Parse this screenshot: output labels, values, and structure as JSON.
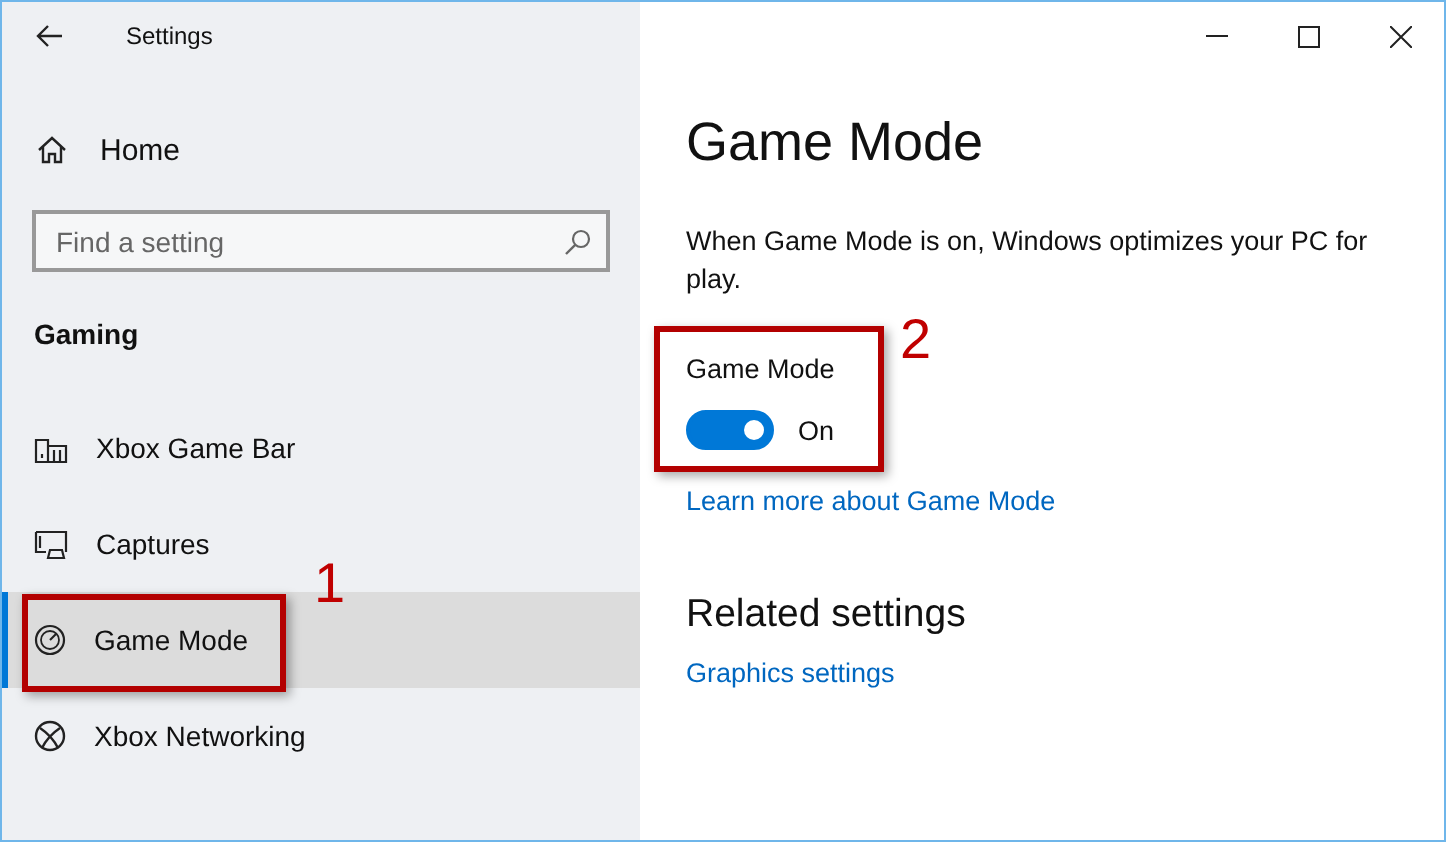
{
  "window": {
    "title": "Settings"
  },
  "sidebar": {
    "home": "Home",
    "search": {
      "placeholder": "Find a setting"
    },
    "section": "Gaming",
    "items": [
      {
        "label": "Xbox Game Bar",
        "selected": false
      },
      {
        "label": "Captures",
        "selected": false
      },
      {
        "label": "Game Mode",
        "selected": true
      },
      {
        "label": "Xbox Networking",
        "selected": false
      }
    ]
  },
  "page": {
    "title": "Game Mode",
    "description": "When Game Mode is on, Windows optimizes your PC for play.",
    "toggle": {
      "label": "Game Mode",
      "on": true,
      "state_text": "On"
    },
    "link": "Learn more about Game Mode",
    "related": {
      "title": "Related settings",
      "links": [
        "Graphics settings"
      ]
    }
  },
  "annotations": [
    {
      "number": "1"
    },
    {
      "number": "2"
    }
  ]
}
